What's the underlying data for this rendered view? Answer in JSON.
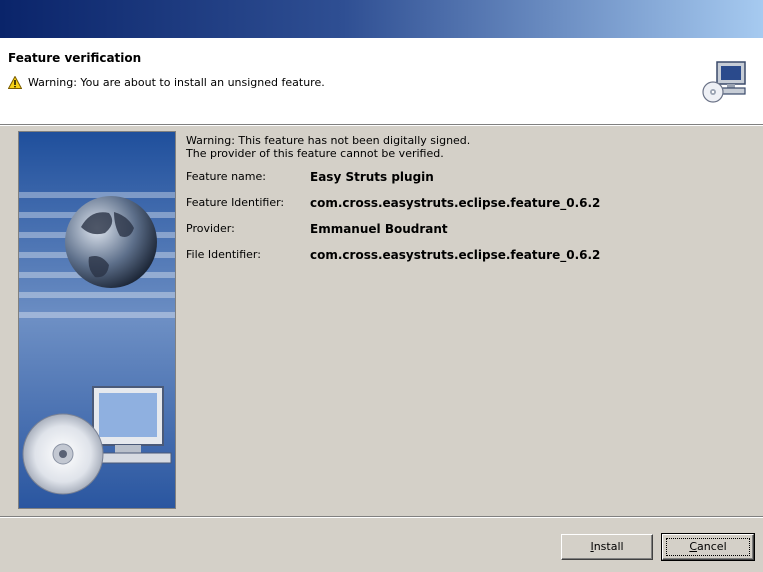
{
  "header": {
    "title": "Feature verification",
    "warning": "Warning: You are about to install an unsigned feature."
  },
  "main": {
    "message_line1": "Warning: This feature has not been digitally signed.",
    "message_line2": "The provider of this feature cannot be verified.",
    "fields": [
      {
        "label": "Feature name:",
        "value": "Easy Struts plugin"
      },
      {
        "label": "Feature Identifier:",
        "value": "com.cross.easystruts.eclipse.feature_0.6.2"
      },
      {
        "label": "Provider:",
        "value": "Emmanuel Boudrant"
      },
      {
        "label": "File Identifier:",
        "value": "com.cross.easystruts.eclipse.feature_0.6.2"
      }
    ]
  },
  "buttons": {
    "install": {
      "mnemonic": "I",
      "rest": "nstall"
    },
    "cancel": {
      "mnemonic": "C",
      "rest": "ancel"
    }
  },
  "colors": {
    "titlebar_start": "#0a246a",
    "titlebar_end": "#a6caf0",
    "dialog_bg": "#d4d0c8"
  },
  "icons": [
    "warning-icon",
    "install-computer-icon",
    "globe-cd-banner-image"
  ]
}
